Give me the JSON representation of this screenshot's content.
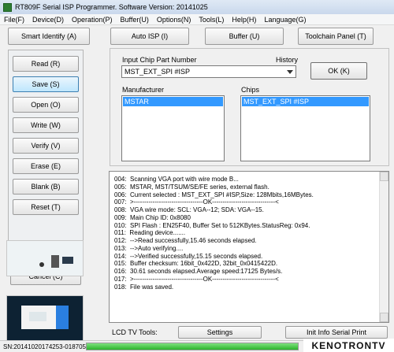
{
  "window": {
    "title": "RT809F Serial ISP Programmer. Software Version: 20141025"
  },
  "menu": [
    "File(F)",
    "Device(D)",
    "Operation(P)",
    "Buffer(U)",
    "Options(N)",
    "Tools(L)",
    "Help(H)",
    "Language(G)"
  ],
  "toolbar": {
    "smart_identify": "Smart Identify (A)",
    "auto_isp": "Auto ISP (I)",
    "buffer": "Buffer (U)",
    "toolchain": "Toolchain Panel (T)"
  },
  "actions": [
    {
      "label": "Read (R)",
      "active": false
    },
    {
      "label": "Save (S)",
      "active": true
    },
    {
      "label": "Open (O)",
      "active": false
    },
    {
      "label": "Write  (W)",
      "active": false
    },
    {
      "label": "Verify (V)",
      "active": false
    },
    {
      "label": "Erase (E)",
      "active": false
    },
    {
      "label": "Blank (B)",
      "active": false
    },
    {
      "label": "Reset  (T)",
      "active": false
    }
  ],
  "cancel_label": "Cancel (C)",
  "chip_panel": {
    "input_label": "Input Chip Part Number",
    "history_label": "History",
    "part_number": "MST_EXT_SPI #ISP",
    "ok_label": "OK (K)",
    "manufacturer_label": "Manufacturer",
    "chips_label": "Chips",
    "manufacturer_selected": "MSTAR",
    "chip_selected": "MST_EXT_SPI #ISP"
  },
  "log": [
    "004:  Scanning VGA port with wire mode B...",
    "005:  MSTAR, MST/TSUM/SE/FE series, external flash.",
    "006:  Current selected : MST_EXT_SPI #ISP,Size: 128Mbits,16MBytes.",
    "007:  >---------------------------------OK------------------------------<",
    "008:  VGA wire mode: SCL: VGA--12; SDA: VGA--15.",
    "009:  Main Chip ID: 0x8080",
    "010:  SPI Flash : EN25F40, Buffer Set to 512KBytes.StatusReg: 0x94.",
    "011:  Reading device.......",
    "012:  -->Read successfully,15.46 seconds elapsed.",
    "013:  -->Auto verifying....",
    "014:  -->Verified successfully,15.15 seconds elapsed.",
    "015:  Buffer checksum: 16bit_0x422D, 32bit_0x0415422D.",
    "016:  30.61 seconds elapsed.Average speed:17125 Bytes/s.",
    "017:  >---------------------------------OK------------------------------<",
    "018:  File was saved."
  ],
  "lcd": {
    "label": "LCD TV Tools:",
    "settings": "Settings",
    "init_info": "Init Info Serial Print"
  },
  "status": {
    "serial": "SN:20141020174253-018705",
    "progress": 1.0
  },
  "watermark": "KENOTRONTV"
}
